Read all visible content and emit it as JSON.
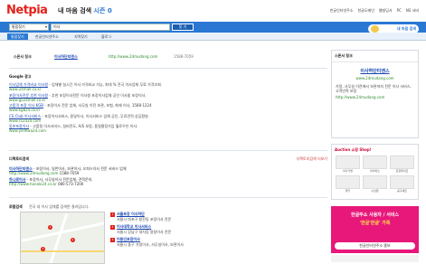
{
  "header": {
    "logo": "Netpia",
    "slogan_main": "내 마음 검색 ",
    "slogan_accent": "시즌 0",
    "links": [
      "한글인터넷주소",
      "한글도메인",
      "웹빌딩서",
      "PC",
      "NS 서버"
    ]
  },
  "search": {
    "scope": "통합찾기",
    "query": "이사",
    "button": "찾 기"
  },
  "tabs": [
    "통합찾기",
    "한글인터넷주소",
    "지역찾기",
    "블로그"
  ],
  "mascot_text": "내 마음 검색",
  "sponsor": {
    "label": "스폰서 링크",
    "title": "이사하단티엔스",
    "url": "http://www.24mudang.com",
    "phone": "1588-7059"
  },
  "google": {
    "title": "Google 광고",
    "items": [
      {
        "title": "이사업체 가격비교 이사왕",
        "desc": " - 업체별 실시간 이사 가격비교 가능, 최대 % 전국 이사업체 무료 가격조회.",
        "url": "www.24mall.co.kr"
      },
      {
        "title": "포장이사전문 추천 이사왕",
        "desc": " - 추천 포장이사전문 이사왕 포장이사업체 공인 이사몰 포장이사.",
        "url": "www.go24mall.co.kr"
      },
      {
        "title": "고품격 포장 이사 KGB",
        "desc": " - 포장이사 전문 업체, 사무실 이전 보관, 보험, 화재 이사, 1588-1224",
        "url": "www.kgb24.co.kr"
      },
      {
        "title": "CS Club 이사서비스",
        "desc": " - 포장이사서비스, 용달이사, 이사서비스 업체 공인, 무료견적 상담환영.",
        "url": "www.cs2424.com"
      },
      {
        "title": "동보포장이사",
        "desc": " - 고품질 이사서비스, 실비전도, A/S 보장, 품질평정가입 월로우인 이사.",
        "url": "www.yeilhwa24.com"
      }
    ]
  },
  "directory": {
    "title": "디렉토리검색",
    "more": "디렉토리검색 더보기",
    "items": [
      {
        "title": "이사하단티엔스",
        "desc": " - 포장이사, 일반이사, 보관이사, 오피스이사 전문 서비스 업체",
        "url": "http://www.24mudang.com",
        "phone": "1588-7059"
      },
      {
        "title": "하나로이사",
        "desc": " - 포장이사, 사무실이사 전문업체, 견적문의.",
        "url": "http://www.hanalo24.co.kr",
        "phone": "080-573-7200"
      }
    ]
  },
  "local": {
    "label": "로컬검색",
    "note": "전국 내 이사 업체를 검색한 결과입니다.",
    "items": [
      {
        "num": "1",
        "title": "서울포장 이사하단",
        "desc": "서울시 마포구 창전동 포장이사 전문"
      },
      {
        "num": "2",
        "title": "이사대학교 이사서비스",
        "desc": "서울시 강남구 대치동 용달이사 전문"
      },
      {
        "num": "3",
        "title": "이동인포장이사",
        "desc": "서울시 중구 가정이사, 사무실이사, 보관이사"
      }
    ]
  },
  "right_box1": {
    "head": "스폰서 링크",
    "name": "이사하단티엔스",
    "url": "www.24mudang.com",
    "desc": "가정, 사무실 이전에서 보관까지 전문 이사 서비스, 고객만족 보장",
    "url2": "http://www.24mudang.com"
  },
  "right_box2": {
    "head": "Auction 쇼핑 Shop!",
    "items": [
      "이사가방",
      "이사박스",
      "포장테이프",
      "행거",
      "수납함",
      "공구세트"
    ]
  },
  "ad": {
    "line1": "한글주소 사용자 / 서비스",
    "line2": "'한글'한글' 가족",
    "line3": "한글인터넷주소 홍보"
  }
}
